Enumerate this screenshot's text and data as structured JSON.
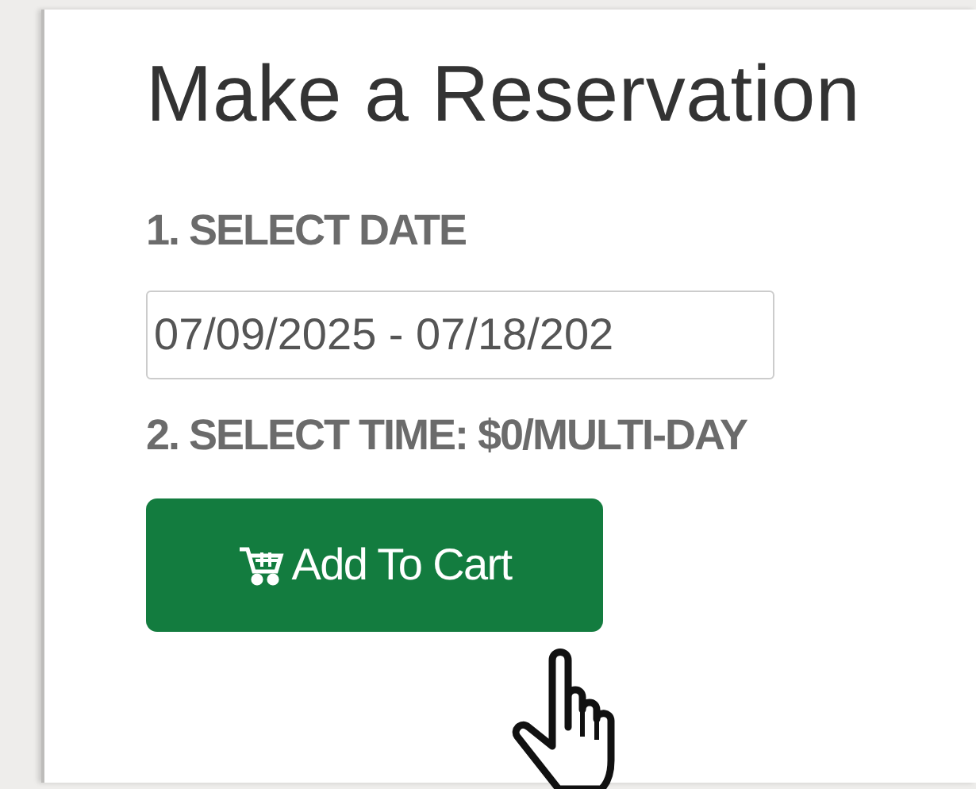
{
  "heading": "Make a Reservation",
  "date_section": {
    "label": "1. SELECT DATE",
    "value": "07/09/2025 - 07/18/202"
  },
  "time_section": {
    "label": "2. SELECT TIME: $0/MULTI-DAY"
  },
  "add_to_cart_button": {
    "label": "Add To Cart"
  }
}
